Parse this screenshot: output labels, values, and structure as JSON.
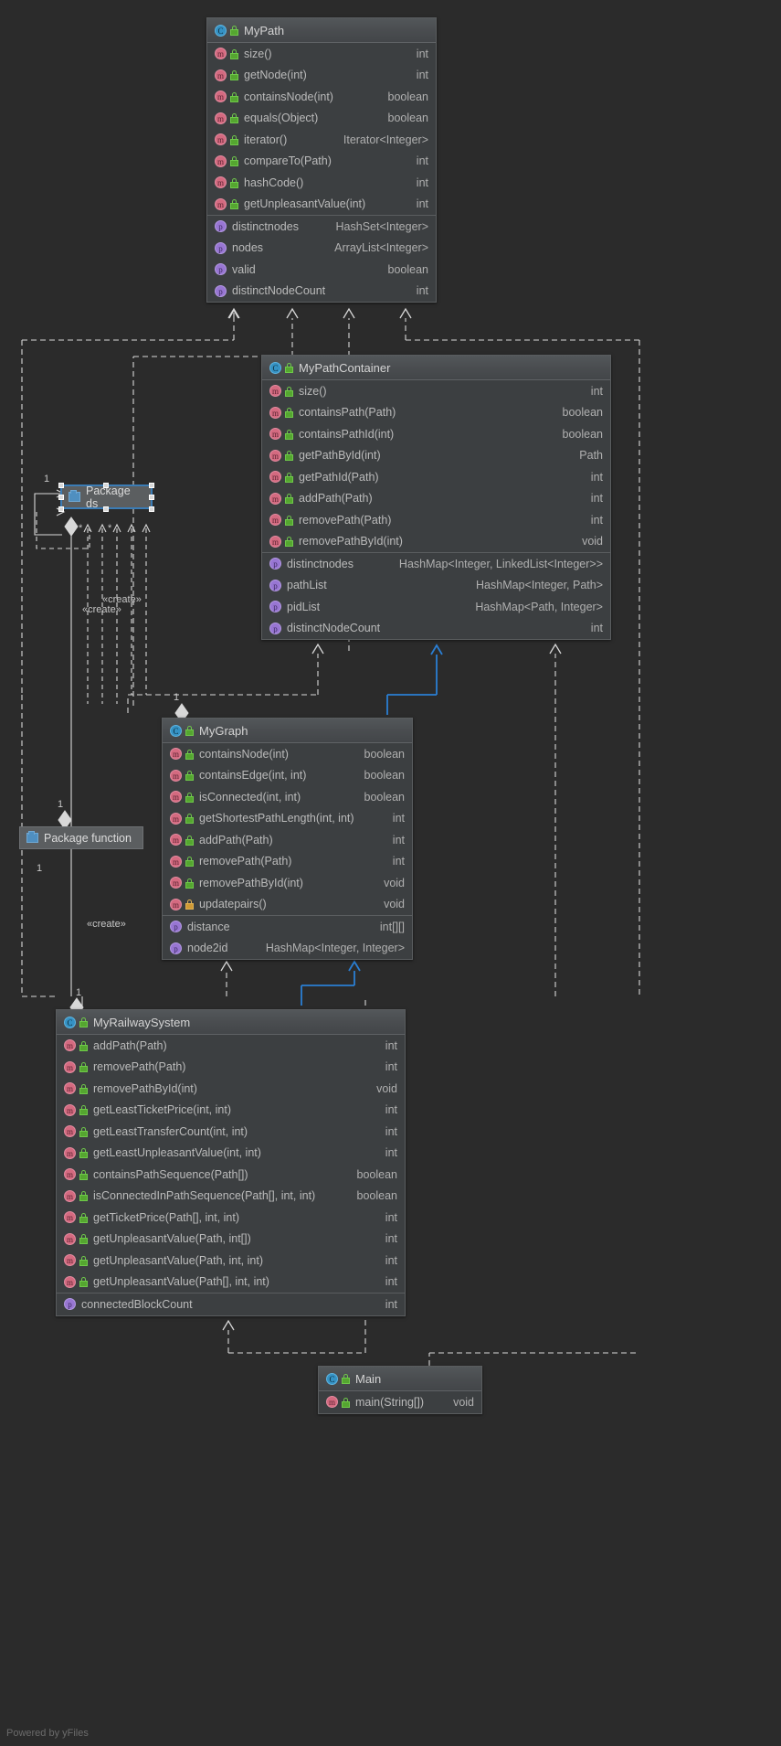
{
  "diagram": {
    "background": "#2b2b2b",
    "watermark": "Powered by yFiles",
    "edge_color": "#d8d8d8",
    "highlight_edge_color": "#2a7fd4"
  },
  "classes": [
    {
      "id": "mypath",
      "name": "MyPath",
      "icon": "class-icon",
      "visibility_icon": "green-lock-icon",
      "methods": [
        {
          "name": "size()",
          "type": "int",
          "vis": "public"
        },
        {
          "name": "getNode(int)",
          "type": "int",
          "vis": "public"
        },
        {
          "name": "containsNode(int)",
          "type": "boolean",
          "vis": "public"
        },
        {
          "name": "equals(Object)",
          "type": "boolean",
          "vis": "public"
        },
        {
          "name": "iterator()",
          "type": "Iterator<Integer>",
          "vis": "public"
        },
        {
          "name": "compareTo(Path)",
          "type": "int",
          "vis": "public"
        },
        {
          "name": "hashCode()",
          "type": "int",
          "vis": "public"
        },
        {
          "name": "getUnpleasantValue(int)",
          "type": "int",
          "vis": "public"
        }
      ],
      "fields": [
        {
          "name": "distinctnodes",
          "type": "HashSet<Integer>"
        },
        {
          "name": "nodes",
          "type": "ArrayList<Integer>"
        },
        {
          "name": "valid",
          "type": "boolean"
        },
        {
          "name": "distinctNodeCount",
          "type": "int"
        }
      ]
    },
    {
      "id": "mypathcontainer",
      "name": "MyPathContainer",
      "icon": "class-icon",
      "visibility_icon": "green-lock-icon",
      "methods": [
        {
          "name": "size()",
          "type": "int",
          "vis": "public"
        },
        {
          "name": "containsPath(Path)",
          "type": "boolean",
          "vis": "public"
        },
        {
          "name": "containsPathId(int)",
          "type": "boolean",
          "vis": "public"
        },
        {
          "name": "getPathById(int)",
          "type": "Path",
          "vis": "public"
        },
        {
          "name": "getPathId(Path)",
          "type": "int",
          "vis": "public"
        },
        {
          "name": "addPath(Path)",
          "type": "int",
          "vis": "public"
        },
        {
          "name": "removePath(Path)",
          "type": "int",
          "vis": "public"
        },
        {
          "name": "removePathById(int)",
          "type": "void",
          "vis": "public"
        }
      ],
      "fields": [
        {
          "name": "distinctnodes",
          "type": "HashMap<Integer, LinkedList<Integer>>"
        },
        {
          "name": "pathList",
          "type": "HashMap<Integer, Path>"
        },
        {
          "name": "pidList",
          "type": "HashMap<Path, Integer>"
        },
        {
          "name": "distinctNodeCount",
          "type": "int"
        }
      ]
    },
    {
      "id": "mygraph",
      "name": "MyGraph",
      "icon": "class-icon",
      "visibility_icon": "green-lock-icon",
      "methods": [
        {
          "name": "containsNode(int)",
          "type": "boolean",
          "vis": "public"
        },
        {
          "name": "containsEdge(int, int)",
          "type": "boolean",
          "vis": "public"
        },
        {
          "name": "isConnected(int, int)",
          "type": "boolean",
          "vis": "public"
        },
        {
          "name": "getShortestPathLength(int, int)",
          "type": "int",
          "vis": "public"
        },
        {
          "name": "addPath(Path)",
          "type": "int",
          "vis": "public"
        },
        {
          "name": "removePath(Path)",
          "type": "int",
          "vis": "public"
        },
        {
          "name": "removePathById(int)",
          "type": "void",
          "vis": "public"
        },
        {
          "name": "updatepairs()",
          "type": "void",
          "vis": "protected"
        }
      ],
      "fields": [
        {
          "name": "distance",
          "type": "int[][]"
        },
        {
          "name": "node2id",
          "type": "HashMap<Integer, Integer>"
        }
      ]
    },
    {
      "id": "myrailwaysystem",
      "name": "MyRailwaySystem",
      "icon": "class-icon",
      "visibility_icon": "green-lock-icon",
      "methods": [
        {
          "name": "addPath(Path)",
          "type": "int",
          "vis": "public"
        },
        {
          "name": "removePath(Path)",
          "type": "int",
          "vis": "public"
        },
        {
          "name": "removePathById(int)",
          "type": "void",
          "vis": "public"
        },
        {
          "name": "getLeastTicketPrice(int, int)",
          "type": "int",
          "vis": "public"
        },
        {
          "name": "getLeastTransferCount(int, int)",
          "type": "int",
          "vis": "public"
        },
        {
          "name": "getLeastUnpleasantValue(int, int)",
          "type": "int",
          "vis": "public"
        },
        {
          "name": "containsPathSequence(Path[])",
          "type": "boolean",
          "vis": "public"
        },
        {
          "name": "isConnectedInPathSequence(Path[], int, int)",
          "type": "boolean",
          "vis": "public"
        },
        {
          "name": "getTicketPrice(Path[], int, int)",
          "type": "int",
          "vis": "public"
        },
        {
          "name": "getUnpleasantValue(Path, int[])",
          "type": "int",
          "vis": "public"
        },
        {
          "name": "getUnpleasantValue(Path, int, int)",
          "type": "int",
          "vis": "public"
        },
        {
          "name": "getUnpleasantValue(Path[], int, int)",
          "type": "int",
          "vis": "public"
        }
      ],
      "fields": [
        {
          "name": "connectedBlockCount",
          "type": "int"
        }
      ]
    },
    {
      "id": "main",
      "name": "Main",
      "icon": "class-icon",
      "visibility_icon": "green-lock-icon",
      "methods": [
        {
          "name": "main(String[])",
          "type": "void",
          "vis": "public"
        }
      ],
      "fields": []
    }
  ],
  "packages": [
    {
      "id": "pkg-ds",
      "label": "Package ds",
      "icon": "package-icon",
      "selected": true
    },
    {
      "id": "pkg-function",
      "label": "Package function",
      "icon": "package-icon",
      "selected": false
    }
  ],
  "multiplicities": [
    {
      "id": "m1",
      "text": "1"
    },
    {
      "id": "m2",
      "text": "*"
    },
    {
      "id": "m3",
      "text": "*"
    },
    {
      "id": "m4",
      "text": "1"
    },
    {
      "id": "m5",
      "text": "1"
    },
    {
      "id": "m6",
      "text": "1"
    },
    {
      "id": "m7",
      "text": "1"
    }
  ],
  "stereotypes": [
    {
      "id": "s1",
      "text": "«create»"
    },
    {
      "id": "s2",
      "text": "«create»"
    },
    {
      "id": "s3",
      "text": "«create»"
    }
  ]
}
